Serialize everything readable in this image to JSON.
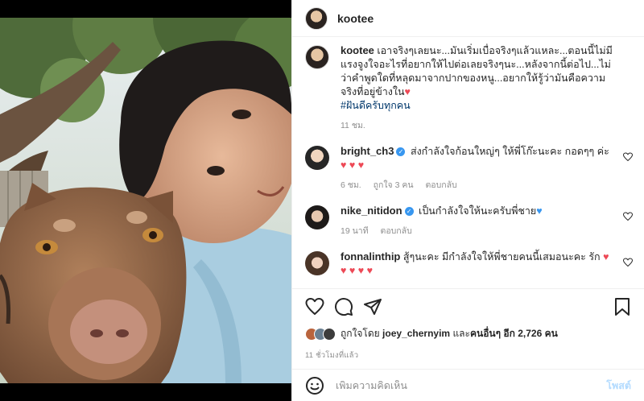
{
  "post": {
    "author": "kootee",
    "photo_alt": "Selfie of a man with a brown dog"
  },
  "caption": {
    "username": "kootee",
    "text": "เอาจริงๆเลยนะ...มันเริ่มเบื่อจริงๆแล้วแหละ...ตอนนี้ไม่มีแรงจูงใจอะไรที่อยากให้ไปต่อเลยจริงๆนะ...หลังจากนี้ต่อไป...ไม่ว่าคำพูดใดที่หลุดมาจากปากของหนู...อยากให้รู้ว่ามันคือความจริงที่อยู่ข้างใน",
    "hashtag": "#ฝันดีครับทุกคน",
    "time": "11 ชม."
  },
  "comments": [
    {
      "username": "bright_ch3",
      "verified": true,
      "text": "ส่งกำลังใจก้อนใหญ่ๆ ให้พี่โก๊ะนะคะ กอดๆๆ ค่ะ",
      "hearts": "♥ ♥ ♥",
      "time": "6 ชม.",
      "likes": "ถูกใจ 3 คน",
      "reply": "ตอบกลับ"
    },
    {
      "username": "nike_nitidon",
      "verified": true,
      "text": "เป็นกำลังใจให้นะครับพี่ชาย",
      "hearts": "♥",
      "time": "19 นาที",
      "likes": "",
      "reply": "ตอบกลับ"
    },
    {
      "username": "fonnalinthip",
      "verified": false,
      "text": "สู้ๆนะคะ มีกำลังใจให้พี่ชายคนนี้เสมอนะคะ รัก",
      "hearts": "♥ ♥ ♥ ♥ ♥",
      "time": "",
      "likes": "",
      "reply": ""
    }
  ],
  "likes": {
    "prefix": "ถูกใจโดย",
    "first_user": "joey_chernyim",
    "and": "และ",
    "others": "คนอื่นๆ อีก 2,726 คน"
  },
  "timestamp": "11 ชั่วโมงที่แล้ว",
  "add_comment": {
    "placeholder": "เพิ่มความคิดเห็น",
    "post_label": "โพสต์"
  },
  "icons": [
    "heart-icon",
    "comment-icon",
    "share-icon",
    "bookmark-icon",
    "emoji-icon"
  ],
  "colors": {
    "heart": "#ed4956",
    "blue_heart": "#3897f0",
    "link": "#00376b",
    "post_button": "#b3dbff"
  }
}
